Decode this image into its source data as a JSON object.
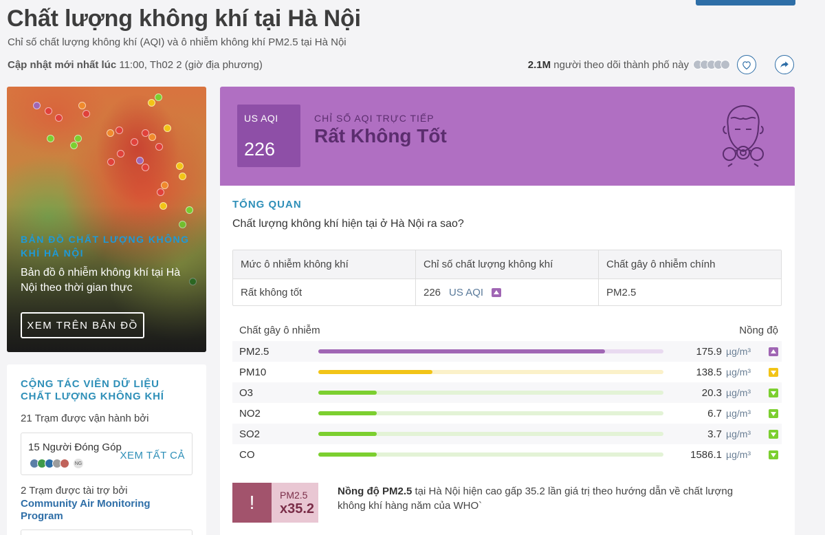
{
  "page": {
    "title": "Chất lượng không khí tại Hà Nội",
    "subtitle": "Chỉ số chất lượng không khí (AQI) và ô nhiễm không khí PM2.5 tại Hà Nội",
    "updated_label": "Cập nhật mới nhất lúc",
    "updated_value": "11:00, Th02 2 (giờ địa phương)",
    "followers_count": "2.1M",
    "followers_label": "người theo dõi thành phố này"
  },
  "map_card": {
    "label": "BẢN ĐỒ CHẤT LƯỢNG KHÔNG KHÍ HÀ NỘI",
    "description": "Bản đồ ô nhiễm không khí tại Hà Nội theo thời gian thực",
    "button": "XEM TRÊN BẢN ĐỒ"
  },
  "contributors": {
    "title": "CỘNG TÁC VIÊN DỮ LIỆU CHẤT LƯỢNG KHÔNG KHÍ",
    "stations_operated": "21 Trạm được vận hành bởi",
    "contributors_count": "15 Người Đóng Góp",
    "see_all": "XEM TẤT CẢ",
    "initials": "NG",
    "stations_sponsored": "2 Trạm được tài trợ bởi",
    "program": "Community Air Monitoring Program"
  },
  "aqi": {
    "label": "US AQI",
    "value": "226",
    "live_label": "CHỈ SỐ AQI TRỰC TIẾP",
    "status": "Rất Không Tốt",
    "banner_color": "#b06fc2"
  },
  "overview": {
    "label": "TỔNG QUAN",
    "question": "Chất lượng không khí hiện tại ở Hà Nội ra sao?",
    "table": {
      "headers": [
        "Mức ô nhiễm không khí",
        "Chỉ số chất lượng không khí",
        "Chất gây ô nhiễm chính"
      ],
      "level": "Rất không tốt",
      "aqi_value": "226",
      "aqi_unit": "US AQI",
      "main_pollutant": "PM2.5"
    }
  },
  "pollutants": {
    "header_name": "Chất gây ô nhiễm",
    "header_conc": "Nồng độ",
    "unit": "µg/m³",
    "items": [
      {
        "name": "PM2.5",
        "value": "175.9",
        "fill": 0.83,
        "color": "#a066b4",
        "track": "#e9daf0",
        "trend": "up",
        "trend_color": "#a066b4"
      },
      {
        "name": "PM10",
        "value": "138.5",
        "fill": 0.33,
        "color": "#f2c417",
        "track": "#fbf1c9",
        "trend": "down",
        "trend_color": "#f2c417"
      },
      {
        "name": "O3",
        "value": "20.3",
        "fill": 0.17,
        "color": "#7ccf30",
        "track": "#e3f3d6",
        "trend": "down",
        "trend_color": "#7ccf30"
      },
      {
        "name": "NO2",
        "value": "6.7",
        "fill": 0.17,
        "color": "#7ccf30",
        "track": "#e3f3d6",
        "trend": "down",
        "trend_color": "#7ccf30"
      },
      {
        "name": "SO2",
        "value": "3.7",
        "fill": 0.17,
        "color": "#7ccf30",
        "track": "#e3f3d6",
        "trend": "down",
        "trend_color": "#7ccf30"
      },
      {
        "name": "CO",
        "value": "1586.1",
        "fill": 0.17,
        "color": "#7ccf30",
        "track": "#e3f3d6",
        "trend": "down",
        "trend_color": "#7ccf30"
      }
    ]
  },
  "alert": {
    "icon": "!",
    "pollutant": "PM2.5",
    "ratio": "x35.2",
    "text_bold": "Nồng độ PM2.5",
    "text_rest": " tại Hà Nội hiện cao gấp 35.2 lần giá trị theo hướng dẫn về chất lượng không khí hàng năm của WHO`"
  },
  "icons": {
    "heart": "heart-icon",
    "share": "share-icon",
    "mask": "gas-mask-face-icon"
  }
}
